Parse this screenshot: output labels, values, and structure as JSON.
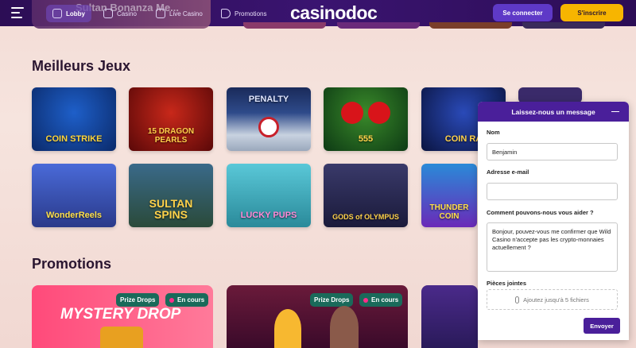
{
  "nav": {
    "peek_title": "Sultan Bonanza Me...",
    "items": [
      {
        "label": "Lobby",
        "icon": "home-icon"
      },
      {
        "label": "Casino",
        "icon": "casino-icon"
      },
      {
        "label": "Live Casino",
        "icon": "live-icon"
      },
      {
        "label": "Promotions",
        "icon": "megaphone-icon"
      }
    ],
    "logo": "casinodoc",
    "login_label": "Se connecter",
    "signup_label": "S'inscrire"
  },
  "best_games": {
    "title": "Meilleurs Jeux",
    "games": [
      {
        "name": "COIN STRIKE"
      },
      {
        "name": "15 DRAGON PEARLS"
      },
      {
        "name": "PENALTY"
      },
      {
        "name": "555"
      },
      {
        "name": "COIN RA"
      },
      {
        "name": ""
      },
      {
        "name": "WonderReels"
      },
      {
        "name": "SULTAN SPINS"
      },
      {
        "name": "LUCKY PUPS"
      },
      {
        "name": "GODS of OLYMPUS"
      },
      {
        "name": "THUNDER COIN"
      }
    ]
  },
  "promotions": {
    "title": "Promotions",
    "cards": [
      {
        "title": "MYSTERY DROP",
        "badge1": "Prize Drops",
        "badge2": "En cours"
      },
      {
        "title": "",
        "badge1": "Prize Drops",
        "badge2": "En cours"
      }
    ]
  },
  "chat": {
    "header": "Laissez-nous un message",
    "name_label": "Nom",
    "name_value": "Benjamin",
    "email_label": "Adresse e-mail",
    "email_value": "",
    "help_label": "Comment pouvons-nous vous aider ?",
    "help_value": "Bonjour, pouvez-vous me confirmer que Wild Casino n'accepte pas les crypto-monnaies actuellement ?",
    "attachments_label": "Pièces jointes",
    "attach_text": "Ajoutez jusqu'à 5 fichiers",
    "send_label": "Envoyer"
  }
}
